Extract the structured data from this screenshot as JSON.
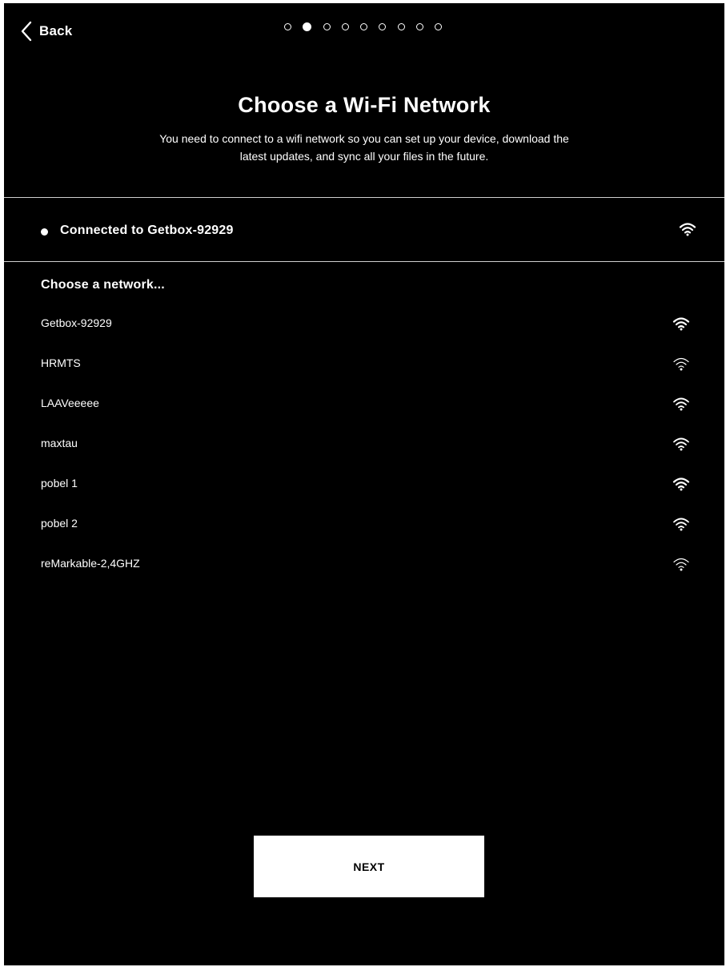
{
  "header": {
    "back_label": "Back",
    "back_icon": "chevron-left-icon",
    "progress": {
      "total_steps": 9,
      "current_step": 2
    }
  },
  "title": "Choose a Wi-Fi Network",
  "subtitle_line1": "You need to connect to a wifi network so you can set up your device, download the",
  "subtitle_line2": "latest updates, and sync all your files in the future.",
  "connection": {
    "label": "Connected to Getbox-92929",
    "status_icon": "connected-dot-icon",
    "signal_icon": "wifi-signal-icon",
    "signal_level": "strong"
  },
  "networks_heading": "Choose a network...",
  "networks": [
    {
      "name": "Getbox-92929",
      "signal_level": "strong",
      "icon": "wifi-signal-icon"
    },
    {
      "name": "HRMTS",
      "signal_level": "weak",
      "icon": "wifi-signal-icon"
    },
    {
      "name": "LAAVeeeee",
      "signal_level": "medium",
      "icon": "wifi-signal-icon"
    },
    {
      "name": "maxtau",
      "signal_level": "medium",
      "icon": "wifi-signal-icon"
    },
    {
      "name": "pobel 1",
      "signal_level": "strong",
      "icon": "wifi-signal-icon"
    },
    {
      "name": "pobel 2",
      "signal_level": "medium",
      "icon": "wifi-signal-icon"
    },
    {
      "name": "reMarkable-2,4GHZ",
      "signal_level": "weak",
      "icon": "wifi-signal-icon"
    }
  ],
  "next_button_label": "NEXT",
  "colors": {
    "background": "#000000",
    "foreground": "#ffffff",
    "divider": "#cfcfcf"
  }
}
